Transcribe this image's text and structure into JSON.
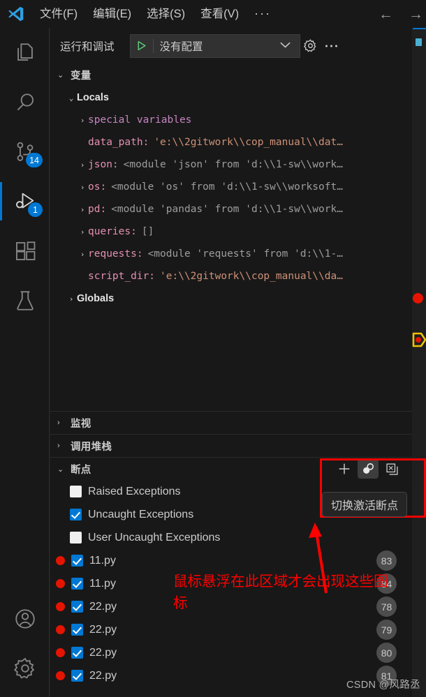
{
  "titlebar": {
    "logo_icon": "vscode-logo",
    "menus": [
      {
        "label": "文件(F)"
      },
      {
        "label": "编辑(E)"
      },
      {
        "label": "选择(S)"
      },
      {
        "label": "查看(V)"
      },
      {
        "label": "···"
      }
    ],
    "back_arrow": "←",
    "forward_arrow": "→"
  },
  "activitybar": {
    "items": [
      {
        "name": "explorer",
        "icon": "files-icon",
        "badge": ""
      },
      {
        "name": "search",
        "icon": "search-icon",
        "badge": ""
      },
      {
        "name": "source-control",
        "icon": "source-control-icon",
        "badge": "14"
      },
      {
        "name": "run-and-debug",
        "icon": "run-debug-icon",
        "badge": "1",
        "active": true
      },
      {
        "name": "extensions",
        "icon": "extensions-icon",
        "badge": ""
      },
      {
        "name": "testing",
        "icon": "beaker-icon",
        "badge": ""
      }
    ],
    "bottom": [
      {
        "name": "accounts",
        "icon": "account-icon"
      },
      {
        "name": "manage",
        "icon": "gear-icon"
      }
    ]
  },
  "sidebar": {
    "title": "运行和调试",
    "config_select": {
      "value": "没有配置",
      "play_icon": "play-icon",
      "chevron": "⌄"
    },
    "gear_icon": "gear-icon",
    "more_icon": "ellipsis-icon"
  },
  "variables": {
    "header": "变量",
    "expanded": true,
    "rows": [
      {
        "indent": 1,
        "twisty": "⌄",
        "kind": "group",
        "name": "Locals"
      },
      {
        "indent": 2,
        "twisty": "›",
        "kind": "special",
        "name": "special variables",
        "value": ""
      },
      {
        "indent": 2,
        "twisty": "",
        "kind": "var",
        "name": "data_path:",
        "value": "'e:\\\\2gitwork\\\\cop_manual\\\\dat…",
        "value_type": "string"
      },
      {
        "indent": 2,
        "twisty": "›",
        "kind": "var",
        "name": "json:",
        "value": "<module 'json' from 'd:\\\\1-sw\\\\work…",
        "value_type": "module"
      },
      {
        "indent": 2,
        "twisty": "›",
        "kind": "var",
        "name": "os:",
        "value": "<module 'os' from 'd:\\\\1-sw\\\\worksoft…",
        "value_type": "module"
      },
      {
        "indent": 2,
        "twisty": "›",
        "kind": "var",
        "name": "pd:",
        "value": "<module 'pandas' from 'd:\\\\1-sw\\\\work…",
        "value_type": "module"
      },
      {
        "indent": 2,
        "twisty": "›",
        "kind": "var",
        "name": "queries:",
        "value": "[]",
        "value_type": "module"
      },
      {
        "indent": 2,
        "twisty": "›",
        "kind": "var",
        "name": "requests:",
        "value": "<module 'requests' from 'd:\\\\1-…",
        "value_type": "module"
      },
      {
        "indent": 2,
        "twisty": "",
        "kind": "var",
        "name": "script_dir:",
        "value": "'e:\\\\2gitwork\\\\cop_manual\\\\da…",
        "value_type": "string"
      },
      {
        "indent": 1,
        "twisty": "›",
        "kind": "group",
        "name": "Globals"
      }
    ]
  },
  "watch": {
    "header": "监视",
    "expanded": false,
    "twisty": "›"
  },
  "callstack": {
    "header": "调用堆栈",
    "expanded": false,
    "twisty": "›"
  },
  "breakpoints": {
    "header": "断点",
    "expanded": true,
    "twisty": "⌄",
    "actions": [
      {
        "name": "add-function-breakpoint",
        "icon": "plus-icon",
        "label": "+",
        "hover": false
      },
      {
        "name": "toggle-activate-breakpoints",
        "icon": "activate-breakpoints-icon",
        "label": "",
        "hover": true
      },
      {
        "name": "remove-all-breakpoints",
        "icon": "remove-all-breakpoints-icon",
        "label": "",
        "hover": false
      }
    ],
    "tooltip": "切换激活断点",
    "exceptions": [
      {
        "label": "Raised Exceptions",
        "checked": false
      },
      {
        "label": "Uncaught Exceptions",
        "checked": true
      },
      {
        "label": "User Uncaught Exceptions",
        "checked": false
      }
    ],
    "files": [
      {
        "file": "11.py",
        "line": "83",
        "checked": true,
        "enabled": true
      },
      {
        "file": "11.py",
        "line": "84",
        "checked": true,
        "enabled": true
      },
      {
        "file": "22.py",
        "line": "78",
        "checked": true,
        "enabled": true
      },
      {
        "file": "22.py",
        "line": "79",
        "checked": true,
        "enabled": true
      },
      {
        "file": "22.py",
        "line": "80",
        "checked": true,
        "enabled": true
      },
      {
        "file": "22.py",
        "line": "81",
        "checked": true,
        "enabled": true
      }
    ]
  },
  "annotation": {
    "text": "鼠标悬浮在此区域才会出现这些图标",
    "color": "#ff0000"
  },
  "watermark": {
    "text": "CSDN @风路丞"
  },
  "colors": {
    "accent": "#0078d4",
    "breakpoint_red": "#e51400",
    "annotation_red": "#ff0000",
    "sidebar_bg": "#181818",
    "editor_bg": "#1f1f1f",
    "string_orange": "#ce9178",
    "varname_pink": "#e48fb1",
    "special_purple": "#c586c0"
  }
}
